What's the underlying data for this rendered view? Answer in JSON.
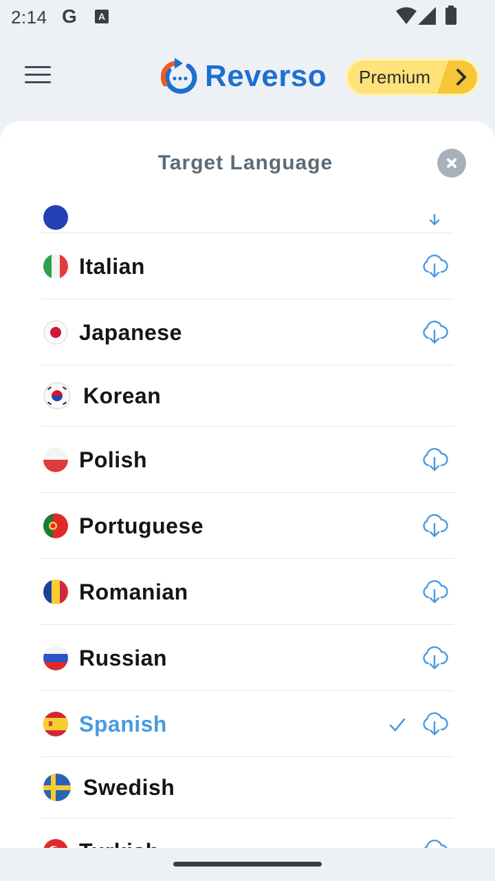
{
  "status_bar": {
    "time": "2:14",
    "g_icon": "G",
    "a_icon": "A"
  },
  "header": {
    "brand": "Reverso",
    "premium_label": "Premium"
  },
  "sheet": {
    "title": "Target Language",
    "languages": [
      {
        "label": "Italian",
        "flag": "flag-italy-icon",
        "downloadable": true,
        "selected": false
      },
      {
        "label": "Japanese",
        "flag": "flag-japan-icon",
        "downloadable": true,
        "selected": false
      },
      {
        "label": "Korean",
        "flag": "flag-korea-icon",
        "downloadable": false,
        "selected": false
      },
      {
        "label": "Polish",
        "flag": "flag-poland-icon",
        "downloadable": true,
        "selected": false
      },
      {
        "label": "Portuguese",
        "flag": "flag-portugal-icon",
        "downloadable": true,
        "selected": false
      },
      {
        "label": "Romanian",
        "flag": "flag-romania-icon",
        "downloadable": true,
        "selected": false
      },
      {
        "label": "Russian",
        "flag": "flag-russia-icon",
        "downloadable": true,
        "selected": false
      },
      {
        "label": "Spanish",
        "flag": "flag-spain-icon",
        "downloadable": true,
        "selected": true
      },
      {
        "label": "Swedish",
        "flag": "flag-sweden-icon",
        "downloadable": false,
        "selected": false
      },
      {
        "label": "Turkish",
        "flag": "flag-turkey-icon",
        "downloadable": true,
        "selected": false
      }
    ]
  },
  "colors": {
    "accent": "#4a9ae0",
    "brand_blue": "#1e6fd0",
    "brand_orange": "#f05a28",
    "premium": "#ffe27a"
  }
}
